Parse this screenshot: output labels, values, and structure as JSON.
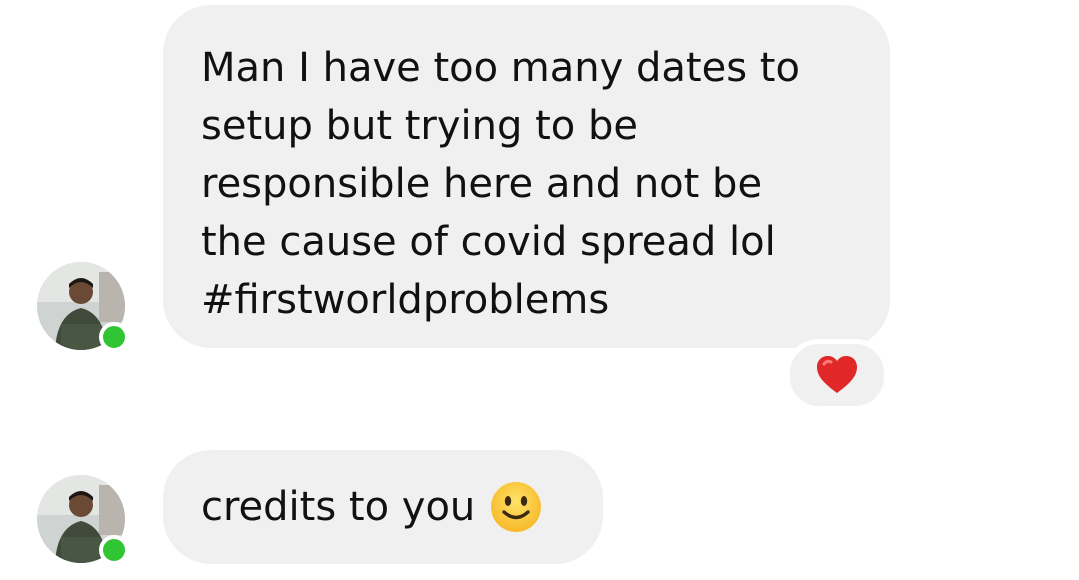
{
  "messages": [
    {
      "sender": "contact",
      "text": "Man I have too many dates to\nsetup but trying to be\nresponsible here and not be\nthe cause of covid spread lol\n#firstworldproblems",
      "reaction": "heart",
      "online": true
    },
    {
      "sender": "contact",
      "text": "credits to you",
      "trailing_emoji": "slightly-smiling-face",
      "online": true
    }
  ],
  "colors": {
    "bubble": "#f0f0f0",
    "online": "#31c534",
    "heart": "#e02828",
    "text": "#111111"
  }
}
